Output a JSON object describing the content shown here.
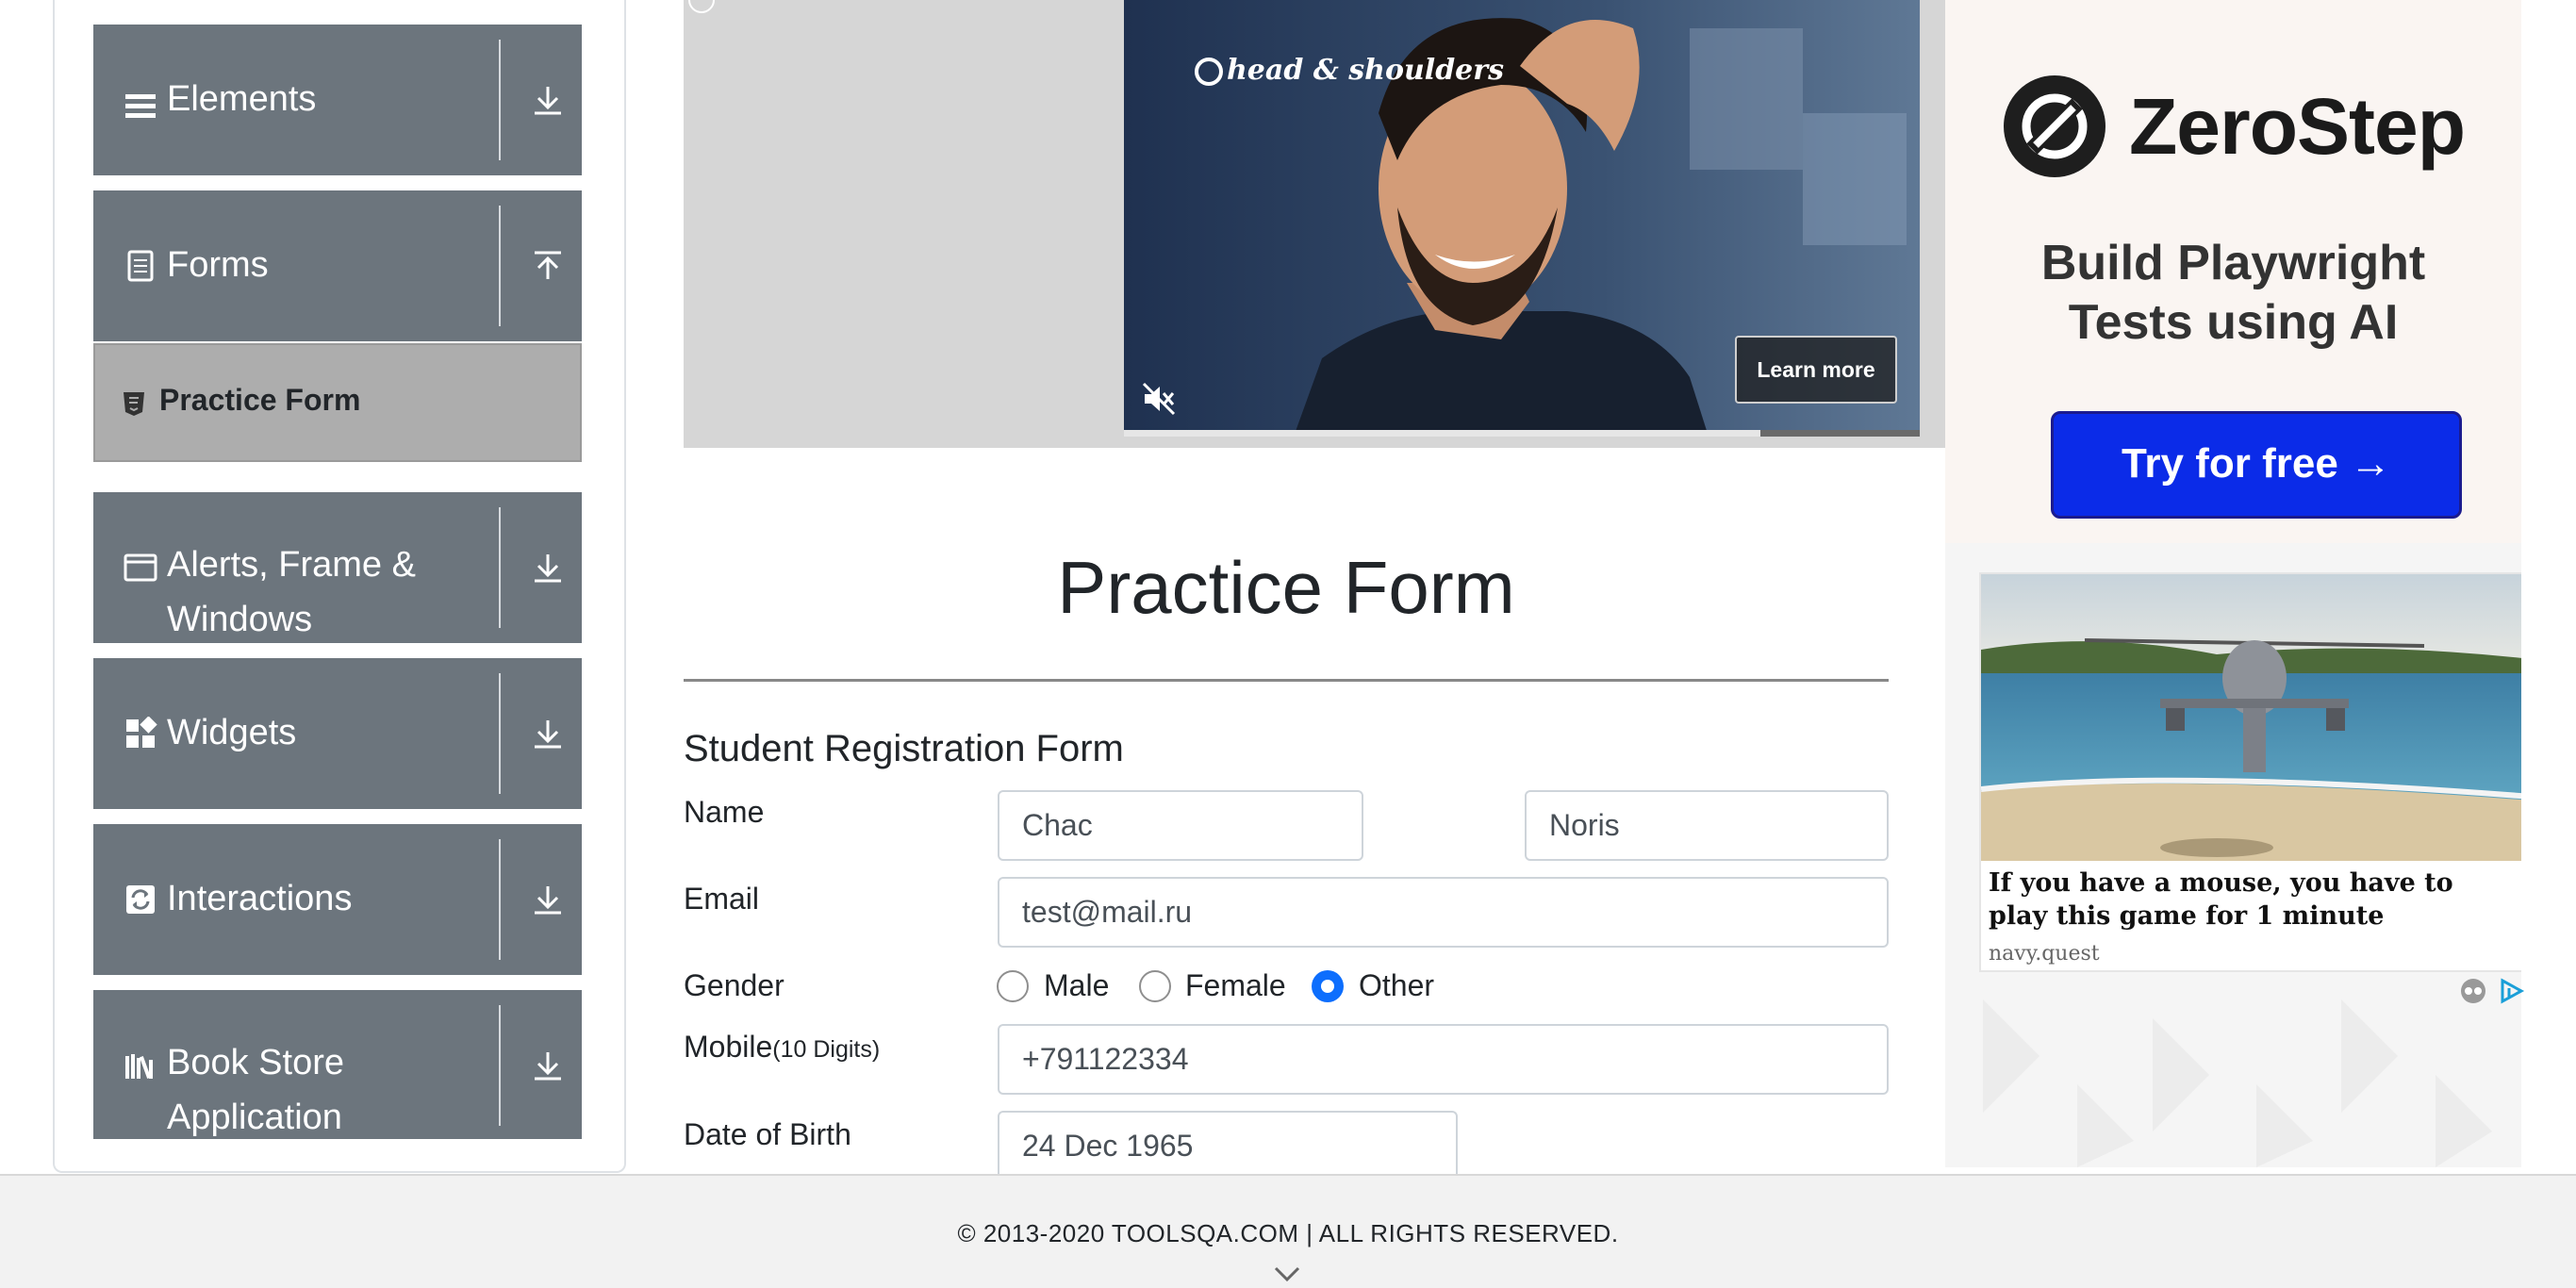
{
  "sidebar": {
    "groups": [
      {
        "label": "Elements",
        "icon": "menu-lines-icon",
        "arrow": "download-arrow-icon"
      },
      {
        "label": "Forms",
        "icon": "document-icon",
        "arrow": "upload-arrow-icon"
      },
      {
        "label": "Alerts, Frame & Windows",
        "icon": "browser-window-icon",
        "arrow": "download-arrow-icon"
      },
      {
        "label": "Widgets",
        "icon": "widgets-grid-icon",
        "arrow": "download-arrow-icon"
      },
      {
        "label": "Interactions",
        "icon": "refresh-square-icon",
        "arrow": "download-arrow-icon"
      },
      {
        "label": "Book Store Application",
        "icon": "books-icon",
        "arrow": "download-arrow-icon"
      }
    ],
    "active_item": {
      "label": "Practice Form",
      "icon": "html5-shield-icon"
    }
  },
  "video_ad": {
    "brand": "head & shoulders",
    "learn_more": "Learn more",
    "progress": 0.8
  },
  "side_ad": {
    "brand_name": "ZeroStep",
    "tagline": "Build Playwright\nTests using AI",
    "cta": "Try for free →",
    "card_title": "If you have a mouse, you have to play this game for 1 minute",
    "card_source": "navy.quest"
  },
  "form": {
    "page_title": "Practice Form",
    "heading": "Student Registration Form",
    "name_label": "Name",
    "first_name": "Chac",
    "last_name": "Noris",
    "email_label": "Email",
    "email": "test@mail.ru",
    "gender_label": "Gender",
    "gender_options": [
      "Male",
      "Female",
      "Other"
    ],
    "gender_selected": "Other",
    "mobile_label": "Mobile",
    "mobile_hint": "(10 Digits)",
    "mobile": "+791122334",
    "dob_label": "Date of Birth",
    "dob": "24 Dec 1965"
  },
  "footer": {
    "copyright": "© 2013-2020 TOOLSQA.COM | ALL RIGHTS RESERVED."
  },
  "colors": {
    "sidebar_header": "#6c757d",
    "sidebar_active": "#adadad",
    "radio_checked": "#0d6efd",
    "zerostep_cta": "#0b2be8"
  }
}
